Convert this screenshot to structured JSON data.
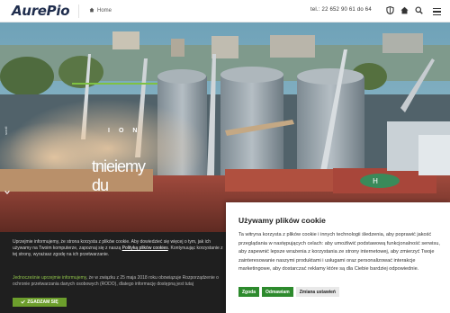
{
  "header": {
    "logo": "AurePio",
    "breadcrumb_home": "Home",
    "phone": "tel.: 22 652 90 61 do 64",
    "icons": [
      "shield-icon",
      "home-icon",
      "search-icon",
      "menu-icon"
    ]
  },
  "hero": {
    "heading_line1": "ION",
    "heading_line2": "tnieiemy du",
    "side_label": "scroll"
  },
  "legal_notice": {
    "text_before_link": "Uprzejmie informujemy, że strona korzysta z plików cookie. Aby dowiedzieć się więcej o tym, jak ich używamy na Twoim komputerze, zapoznaj się z naszą ",
    "link_text": "Polityką plików cookies",
    "text_after_link": ". Kontynuując korzystanie z tej strony, wyrażasz zgodę na ich przetwarzanie.",
    "rodo_lead": "Jednocześnie uprzejmie informujemy",
    "rodo_text": ", że w związku z 25 maja 2018 roku obowiązuje Rozporządzenie o ochronie przetwarzania danych osobowych (RODO), dlatego informację dostępną jest tutaj",
    "agree_label": "ZGADZAM SIĘ"
  },
  "cookie_dialog": {
    "title": "Używamy plików cookie",
    "body": "Ta witryna korzysta z plików cookie i innych technologii śledzenia, aby poprawić jakość przeglądania w następujących celach: aby umożliwić podstawową funkcjonalność serwisu, aby zapewnić lepsze wrażenia z korzystania ze strony internetowej, aby zmierzyć Twoje zainteresowanie naszymi produktami i usługami oraz personalizować interakcje marketingowe, aby dostarczać reklamy które są dla Ciebie bardziej odpowiednie.",
    "accept_label": "Zgoda",
    "reject_label": "Odmawiam",
    "settings_label": "Zmiana ustawień"
  },
  "colors": {
    "logo": "#1f2d4d",
    "accent_green": "#2d8a2d",
    "legal_bg": "#1f1f1f"
  }
}
